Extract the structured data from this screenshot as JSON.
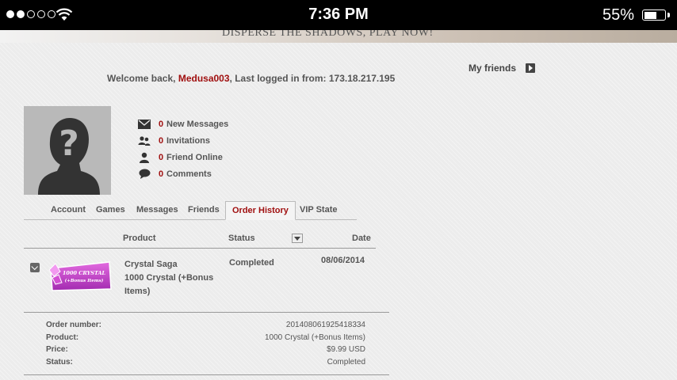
{
  "status_bar": {
    "time": "7:36 PM",
    "battery_percent": "55%",
    "battery_level": 0.55,
    "signal_dots_filled": 2,
    "signal_dots_total": 5
  },
  "banner": {
    "text": "DISPERSE THE SHADOWS, PLAY NOW!"
  },
  "welcome": {
    "prefix": "Welcome back, ",
    "username": "Medusa003",
    "suffix": ", Last logged in from: 173.18.217.195"
  },
  "friends_link": {
    "label": "My friends"
  },
  "stats": [
    {
      "icon": "envelope-icon",
      "count": "0",
      "label": "New Messages"
    },
    {
      "icon": "invitations-icon",
      "count": "0",
      "label": "Invitations"
    },
    {
      "icon": "person-icon",
      "count": "0",
      "label": "Friend Online"
    },
    {
      "icon": "comment-icon",
      "count": "0",
      "label": "Comments"
    }
  ],
  "tabs": [
    {
      "label": "Account"
    },
    {
      "label": "Games"
    },
    {
      "label": "Messages"
    },
    {
      "label": "Friends"
    },
    {
      "label": "Order History",
      "active": true
    },
    {
      "label": "VIP State"
    }
  ],
  "table": {
    "headers": {
      "product": "Product",
      "status": "Status",
      "date": "Date"
    },
    "rows": [
      {
        "product_line1": "Crystal Saga",
        "product_line2": "1000 Crystal (+Bonus",
        "product_line3": "Items)",
        "status": "Completed",
        "date": "08/06/2014",
        "image_label_1": "1000 CRYSTAL",
        "image_label_2": "(+Bonus Items)"
      }
    ]
  },
  "order_details": {
    "order_number_label": "Order number:",
    "order_number": "201408061925418334",
    "product_label": "Product:",
    "product": "1000 Crystal (+Bonus Items)",
    "price_label": "Price:",
    "price": "$9.99 USD",
    "status_label": "Status:",
    "status": "Completed"
  },
  "colors": {
    "accent": "#a01010",
    "text": "#555555",
    "status_bar_bg": "#000000"
  }
}
